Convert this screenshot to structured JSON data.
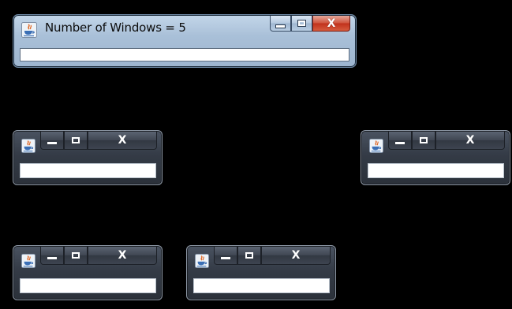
{
  "main_window": {
    "title": "Number of Windows = 5",
    "icon": "java-icon",
    "controls": {
      "minimize": "minimize-icon",
      "maximize": "maximize-icon",
      "close": "X"
    }
  },
  "child_windows": [
    {
      "icon": "java-icon",
      "close": "X"
    },
    {
      "icon": "java-icon",
      "close": "X"
    },
    {
      "icon": "java-icon",
      "close": "X"
    },
    {
      "icon": "java-icon",
      "close": "X"
    }
  ]
}
